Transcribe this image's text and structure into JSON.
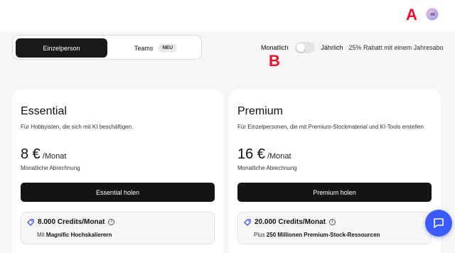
{
  "annotations": {
    "marker_a": "A",
    "marker_b": "B"
  },
  "plan_tabs": [
    {
      "label": "Einzelperson",
      "active": true
    },
    {
      "label": "Teams",
      "badge": "NEU",
      "active": false
    }
  ],
  "billing_toggle": {
    "monthly_label": "Monatlich",
    "yearly_label": "Jährlich",
    "discount_text": "25% Rabatt mit einem Jahresabo",
    "yearly_selected": false
  },
  "plans": [
    {
      "name": "Essential",
      "description": "Für Hobbyisten, die sich mit KI beschäftigen.",
      "price": "8 €",
      "price_unit": "/Monat",
      "billing_note": "Monatliche Abrechnung",
      "cta": "Essential holen",
      "credits_title": "8.000 Credits/Monat",
      "credits_prefix": "Mit",
      "credits_highlight": "Magnific Hochskalierern"
    },
    {
      "name": "Premium",
      "description": "Für Einzelpersonen, die mit Premium-Stockmaterial und KI-Tools erstellen",
      "price": "16 €",
      "price_unit": "/Monat",
      "billing_note": "Monatliche Abrechnung",
      "cta": "Premium holen",
      "credits_title": "20.000 Credits/Monat",
      "credits_prefix": "Plus",
      "credits_highlight": "250 Millionen Premium-Stock-Ressourcen"
    }
  ],
  "icons": {
    "avatar": "avatar-icon",
    "tag": "tag-icon",
    "info": "info-icon",
    "chat": "chat-icon"
  },
  "colors": {
    "accent_blue": "#3b5bff",
    "annotation_red": "#e8102a",
    "button_dark": "#141414"
  }
}
